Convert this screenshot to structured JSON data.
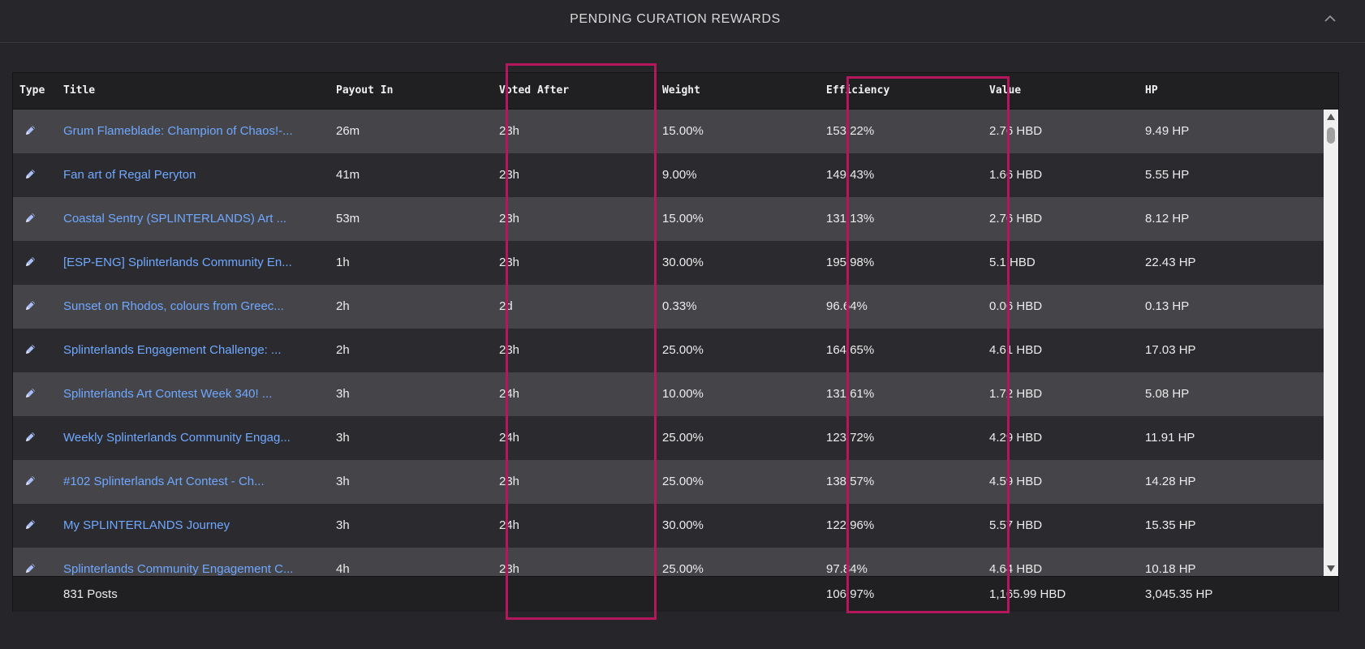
{
  "panel": {
    "title": "PENDING CURATION REWARDS",
    "icon": "chevron-up-icon"
  },
  "columns": {
    "type": "Type",
    "title": "Title",
    "payout_in": "Payout In",
    "voted_after": "Voted After",
    "weight": "Weight",
    "efficiency": "Efficiency",
    "value": "Value",
    "hp": "HP"
  },
  "rows": [
    {
      "title": "Grum Flameblade: Champion of Chaos!-...",
      "payout_in": "26m",
      "voted_after": "23h",
      "weight": "15.00%",
      "efficiency": "153.22%",
      "value": "2.76 HBD",
      "hp": "9.49 HP"
    },
    {
      "title": "Fan art of Regal Peryton",
      "payout_in": "41m",
      "voted_after": "23h",
      "weight": "9.00%",
      "efficiency": "149.43%",
      "value": "1.66 HBD",
      "hp": "5.55 HP"
    },
    {
      "title": "Coastal Sentry (SPLINTERLANDS) Art ...",
      "payout_in": "53m",
      "voted_after": "23h",
      "weight": "15.00%",
      "efficiency": "131.13%",
      "value": "2.76 HBD",
      "hp": "8.12 HP"
    },
    {
      "title": "[ESP-ENG] Splinterlands Community En...",
      "payout_in": "1h",
      "voted_after": "23h",
      "weight": "30.00%",
      "efficiency": "195.98%",
      "value": "5.1 HBD",
      "hp": "22.43 HP"
    },
    {
      "title": "Sunset on Rhodos, colours from Greec...",
      "payout_in": "2h",
      "voted_after": "2d",
      "weight": "0.33%",
      "efficiency": "96.64%",
      "value": "0.06 HBD",
      "hp": "0.13 HP"
    },
    {
      "title": "Splinterlands Engagement Challenge: ...",
      "payout_in": "2h",
      "voted_after": "23h",
      "weight": "25.00%",
      "efficiency": "164.65%",
      "value": "4.61 HBD",
      "hp": "17.03 HP"
    },
    {
      "title": "Splinterlands Art Contest Week 340! ...",
      "payout_in": "3h",
      "voted_after": "24h",
      "weight": "10.00%",
      "efficiency": "131.61%",
      "value": "1.72 HBD",
      "hp": "5.08 HP"
    },
    {
      "title": "Weekly Splinterlands Community Engag...",
      "payout_in": "3h",
      "voted_after": "24h",
      "weight": "25.00%",
      "efficiency": "123.72%",
      "value": "4.29 HBD",
      "hp": "11.91 HP"
    },
    {
      "title": "#102 Splinterlands Art Contest - Ch...",
      "payout_in": "3h",
      "voted_after": "23h",
      "weight": "25.00%",
      "efficiency": "138.57%",
      "value": "4.59 HBD",
      "hp": "14.28 HP"
    },
    {
      "title": "My SPLINTERLANDS Journey",
      "payout_in": "3h",
      "voted_after": "24h",
      "weight": "30.00%",
      "efficiency": "122.96%",
      "value": "5.57 HBD",
      "hp": "15.35 HP"
    },
    {
      "title": "Splinterlands Community Engagement C...",
      "payout_in": "4h",
      "voted_after": "23h",
      "weight": "25.00%",
      "efficiency": "97.84%",
      "value": "4.64 HBD",
      "hp": "10.18 HP"
    }
  ],
  "row_icon": "pencil-icon",
  "footer": {
    "posts": "831 Posts",
    "efficiency": "106.97%",
    "value": "1,165.99 HBD",
    "hp": "3,045.35 HP"
  },
  "colors": {
    "background": "#26262a",
    "row_odd": "#444449",
    "row_even": "#2b2b2f",
    "link": "#6fa8ff",
    "highlight": "#b5175d"
  }
}
